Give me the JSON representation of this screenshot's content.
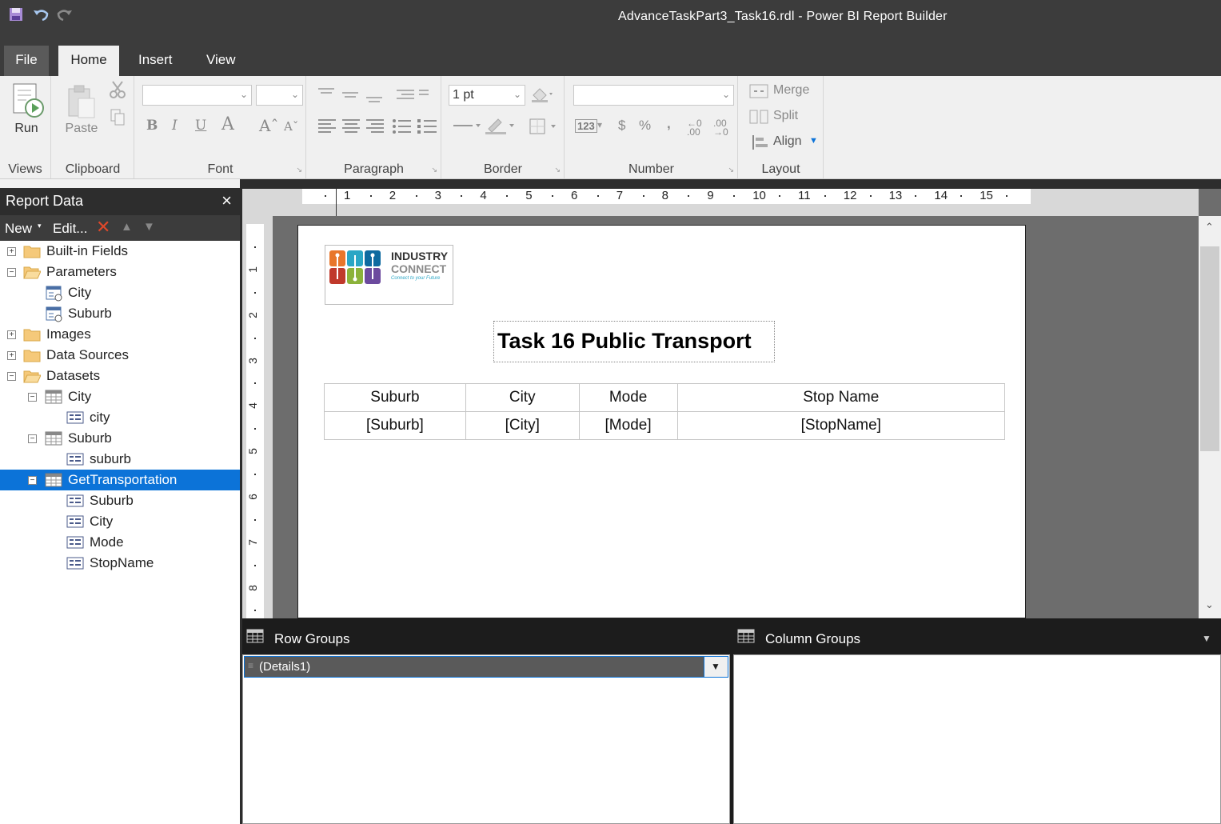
{
  "window": {
    "title": "AdvanceTaskPart3_Task16.rdl  -  Power  BI  Report Builder"
  },
  "menu_tabs": [
    "File",
    "Home",
    "Insert",
    "View"
  ],
  "ribbon": {
    "views": {
      "run_label": "Run",
      "group_label": "Views"
    },
    "clipboard": {
      "paste_label": "Paste",
      "group_label": "Clipboard"
    },
    "font": {
      "group_label": "Font"
    },
    "paragraph": {
      "group_label": "Paragraph"
    },
    "border": {
      "width_value": "1 pt",
      "group_label": "Border"
    },
    "number": {
      "group_label": "Number"
    },
    "layout": {
      "merge_label": "Merge",
      "split_label": "Split",
      "align_label": "Align",
      "group_label": "Layout"
    }
  },
  "report_data": {
    "title": "Report Data",
    "toolbar": {
      "new_label": "New",
      "edit_label": "Edit..."
    },
    "tree": [
      {
        "label": "Built-in Fields"
      },
      {
        "label": "Parameters"
      },
      {
        "label": "City"
      },
      {
        "label": "Suburb"
      },
      {
        "label": "Images"
      },
      {
        "label": "Data Sources"
      },
      {
        "label": "Datasets"
      },
      {
        "label": "City"
      },
      {
        "label": "city"
      },
      {
        "label": "Suburb"
      },
      {
        "label": "suburb"
      },
      {
        "label": "GetTransportation"
      },
      {
        "label": "Suburb"
      },
      {
        "label": "City"
      },
      {
        "label": "Mode"
      },
      {
        "label": "StopName"
      }
    ]
  },
  "rulers": {
    "top_numbers": [
      "1",
      "2",
      "3",
      "4",
      "5",
      "6",
      "7",
      "8",
      "9",
      "10",
      "11",
      "12",
      "13",
      "14",
      "15"
    ],
    "left_numbers": [
      "1",
      "2",
      "3",
      "4",
      "5",
      "6",
      "7",
      "8"
    ]
  },
  "report": {
    "logo": {
      "line1": "INDUSTRY",
      "line2": "CONNECT",
      "tagline": "Connect to your Future"
    },
    "title": "Task 16 Public Transport",
    "table": {
      "headers": [
        "Suburb",
        "City",
        "Mode",
        "Stop Name"
      ],
      "fields": [
        "[Suburb]",
        "[City]",
        "[Mode]",
        "[StopName]"
      ]
    }
  },
  "groups": {
    "row_groups_label": "Row Groups",
    "column_groups_label": "Column Groups",
    "row_group_item": "(Details1)"
  },
  "colors": {
    "selection": "#0c73d8",
    "chrome_dark": "#3c3c3c",
    "panel_dark": "#1c1c1c"
  }
}
